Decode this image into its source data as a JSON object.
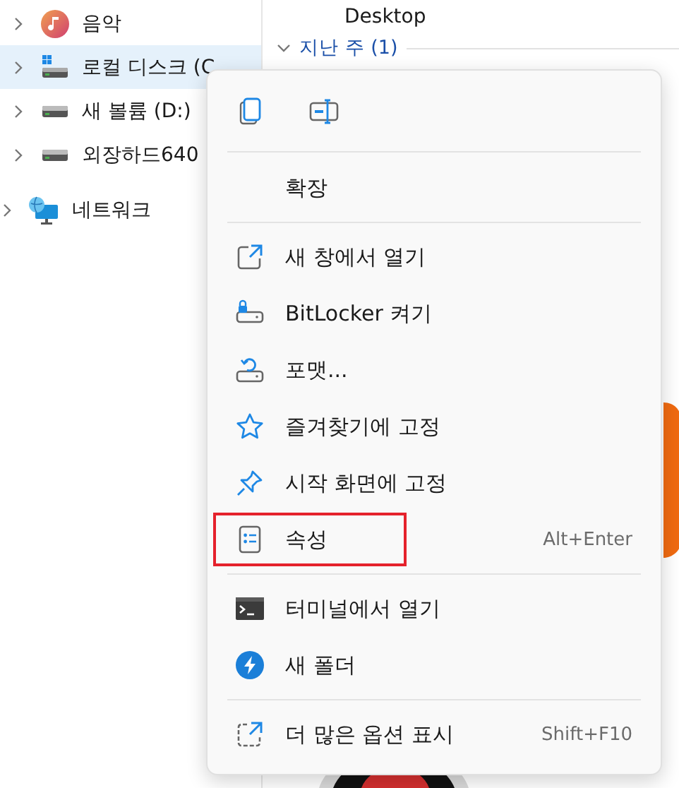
{
  "sidebar": {
    "nested_items": [
      {
        "label": "음악",
        "kind": "music",
        "selected": false
      },
      {
        "label": "로컬 디스크 (C",
        "kind": "system-drive",
        "selected": true
      },
      {
        "label": "새 볼륨 (D:)",
        "kind": "drive",
        "selected": false
      },
      {
        "label": "외장하드640",
        "kind": "drive",
        "selected": false
      }
    ],
    "items": [
      {
        "label": "네트워크",
        "kind": "network",
        "selected": false
      }
    ]
  },
  "content": {
    "item_label": "Desktop",
    "group_header": "지난 주 (1)"
  },
  "context_menu": {
    "icon_buttons": [
      {
        "kind": "copy"
      },
      {
        "kind": "rename"
      }
    ],
    "sections": [
      [
        {
          "label": "확장",
          "kind": "none",
          "outlined": false
        }
      ],
      [
        {
          "label": "새 창에서 열기",
          "kind": "open-window",
          "outlined": false
        },
        {
          "label": "BitLocker 켜기",
          "kind": "bitlocker",
          "outlined": false
        },
        {
          "label": "포맷...",
          "kind": "format",
          "outlined": false
        },
        {
          "label": "즐겨찾기에 고정",
          "kind": "star",
          "outlined": false
        },
        {
          "label": "시작 화면에 고정",
          "kind": "pin",
          "outlined": false
        },
        {
          "label": "속성",
          "kind": "properties",
          "outlined": true,
          "shortcut": "Alt+Enter"
        }
      ],
      [
        {
          "label": "터미널에서 열기",
          "kind": "terminal",
          "outlined": false
        },
        {
          "label": "새 폴더",
          "kind": "bolt",
          "outlined": false
        }
      ],
      [
        {
          "label": "더 많은 옵션 표시",
          "kind": "more-options",
          "outlined": false,
          "shortcut": "Shift+F10"
        }
      ]
    ]
  }
}
